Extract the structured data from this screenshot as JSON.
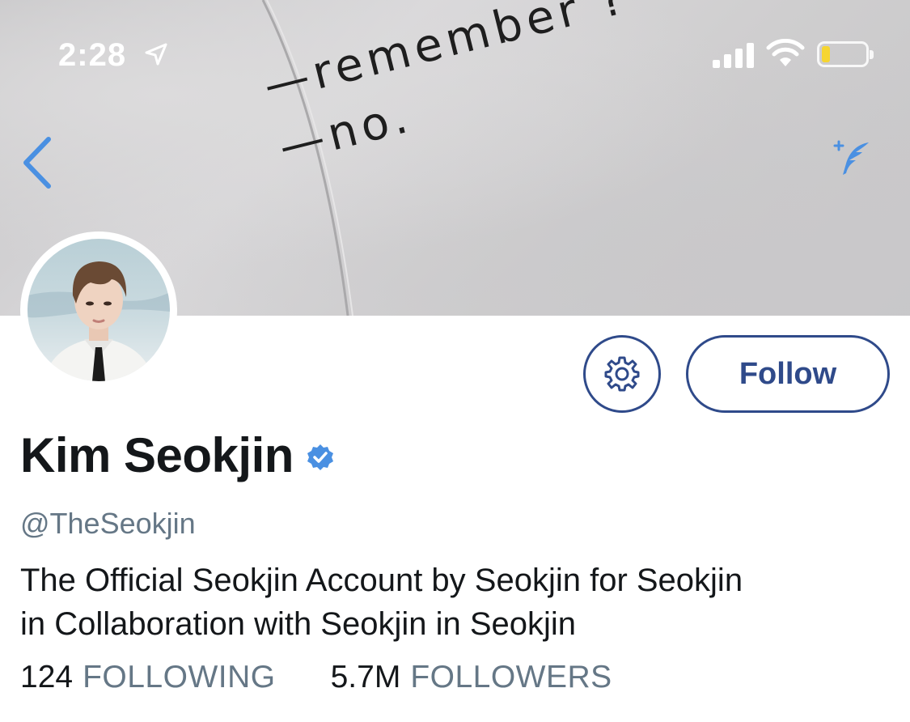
{
  "status_bar": {
    "time": "2:28",
    "battery_level": 0.2,
    "battery_color": "#f6d531"
  },
  "banner": {
    "lines": [
      "remember ?",
      "no."
    ]
  },
  "navigation": {
    "back_icon": "chevron-left-icon",
    "compose_icon": "quill-sparkle-icon",
    "accent_color": "#4a90e2"
  },
  "profile": {
    "display_name": "Kim Seokjin",
    "verified": true,
    "handle": "@TheSeokjin",
    "bio_lines": [
      "The Official Seokjin Account by Seokjin for Seokjin",
      "in Collaboration with Seokjin in Seokjin"
    ],
    "follow_label": "Follow",
    "button_color": "#2f4a8a"
  },
  "stats": {
    "following_count": "124",
    "following_label": "FOLLOWING",
    "followers_count": "5.7M",
    "followers_label": "FOLLOWERS"
  }
}
